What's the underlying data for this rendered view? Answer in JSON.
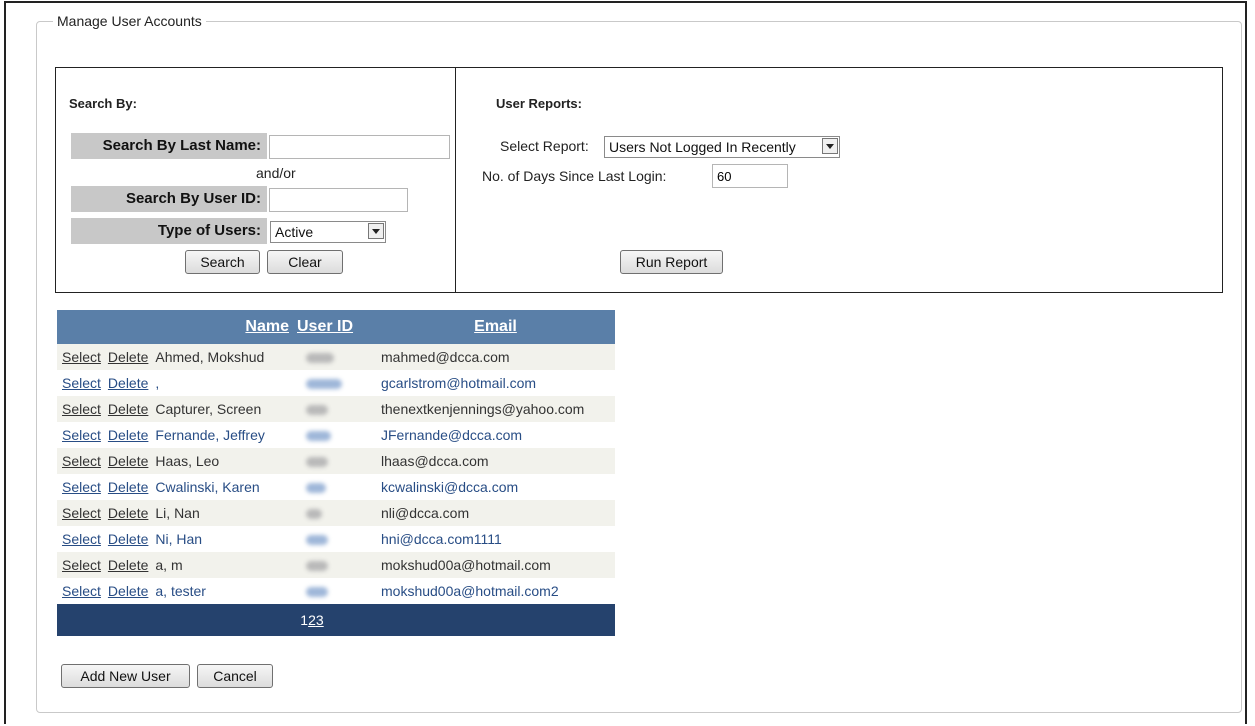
{
  "fieldset": {
    "legend": "Manage User Accounts"
  },
  "search": {
    "title": "Search By:",
    "last_name_label": "Search By Last Name:",
    "last_name_value": "",
    "and_or": "and/or",
    "user_id_label": "Search By User ID:",
    "user_id_value": "",
    "type_label": "Type of Users:",
    "type_selected": "Active",
    "search_button": "Search",
    "clear_button": "Clear"
  },
  "reports": {
    "title": "User Reports:",
    "select_label": "Select Report:",
    "selected_report": "Users Not Logged In Recently",
    "days_label": "No. of Days Since Last Login:",
    "days_value": "60",
    "run_button": "Run Report"
  },
  "grid": {
    "headers": {
      "name": "Name",
      "user_id": "User ID",
      "email": "Email"
    },
    "action_select": "Select",
    "action_delete": "Delete",
    "rows": [
      {
        "name": "Ahmed, Mokshud",
        "email": "mahmed@dcca.com"
      },
      {
        "name": ",",
        "email": "gcarlstrom@hotmail.com"
      },
      {
        "name": "Capturer, Screen",
        "email": "thenextkenjennings@yahoo.com"
      },
      {
        "name": "Fernande, Jeffrey",
        "email": "JFernande@dcca.com"
      },
      {
        "name": "Haas, Leo",
        "email": "lhaas@dcca.com"
      },
      {
        "name": "Cwalinski, Karen",
        "email": "kcwalinski@dcca.com"
      },
      {
        "name": "Li, Nan",
        "email": "nli@dcca.com"
      },
      {
        "name": "Ni, Han",
        "email": "hni@dcca.com1111"
      },
      {
        "name": "a, m",
        "email": "mokshud00a@hotmail.com"
      },
      {
        "name": "a, tester",
        "email": "mokshud00a@hotmail.com2"
      }
    ],
    "pages": [
      "1",
      "2",
      "3"
    ],
    "current_page": "1"
  },
  "footer": {
    "add_button": "Add New User",
    "cancel_button": "Cancel"
  }
}
